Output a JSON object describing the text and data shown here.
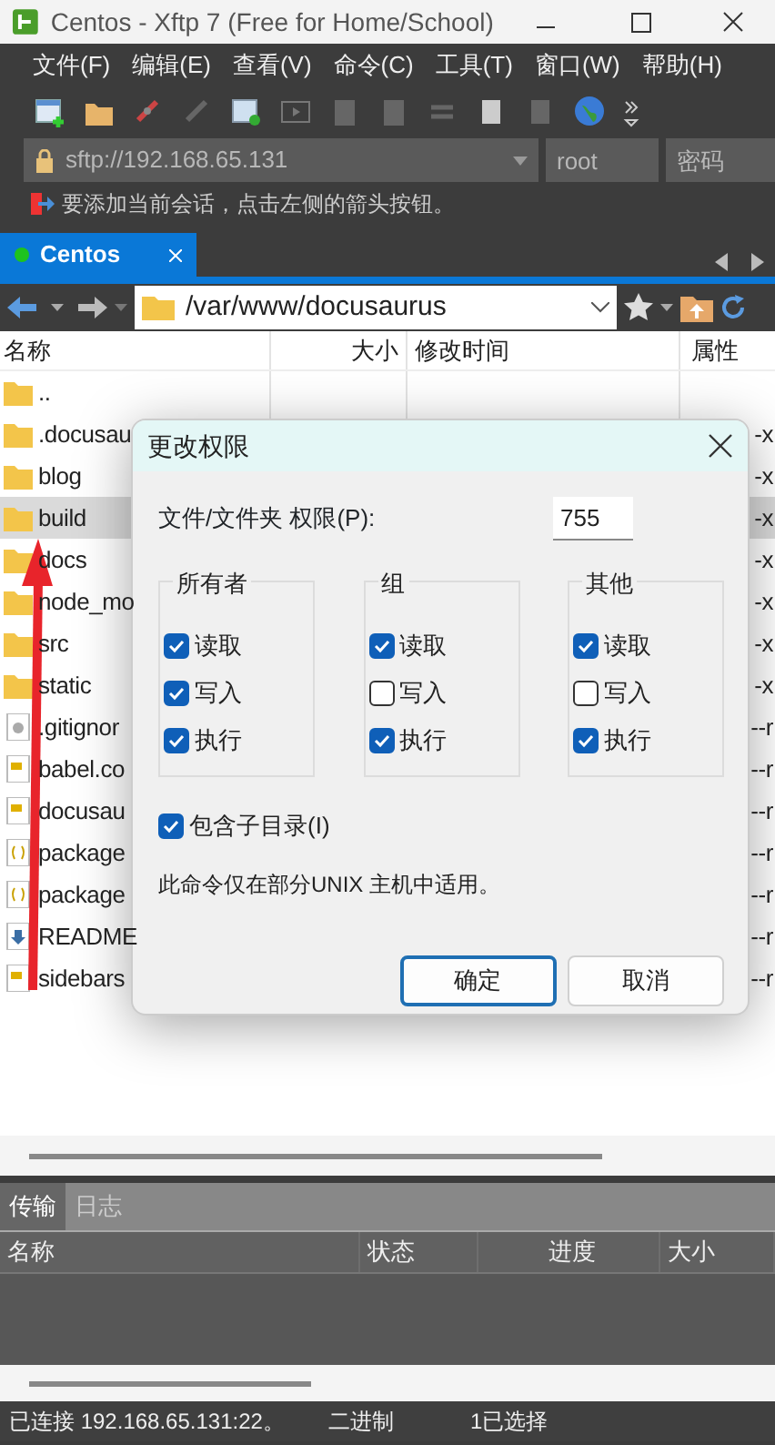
{
  "window": {
    "title": "Centos - Xftp 7 (Free for Home/School)"
  },
  "menu": [
    "文件(F)",
    "编辑(E)",
    "查看(V)",
    "命令(C)",
    "工具(T)",
    "窗口(W)",
    "帮助(H)"
  ],
  "address": {
    "url": "sftp://192.168.65.131",
    "user": "root",
    "placeholder": "密码"
  },
  "hint": "要添加当前会话，点击左侧的箭头按钮。",
  "session_tabs": [
    {
      "label": "Centos",
      "selected": true,
      "connected": true
    }
  ],
  "path": "/var/www/docusaurus",
  "file_table": {
    "columns": [
      "名称",
      "大小",
      "修改时间",
      "属性"
    ],
    "rows": [
      {
        "name": "..",
        "kind": "folder",
        "selected": false
      },
      {
        "name": ".docusau",
        "kind": "folder",
        "attributes": "-x",
        "selected": false
      },
      {
        "name": "blog",
        "kind": "folder",
        "attributes": "-x",
        "selected": false
      },
      {
        "name": "build",
        "kind": "folder",
        "attributes": "-x",
        "selected": true
      },
      {
        "name": "docs",
        "kind": "folder",
        "attributes": "-x",
        "selected": false
      },
      {
        "name": "node_mo",
        "kind": "folder",
        "attributes": "-x",
        "selected": false
      },
      {
        "name": "src",
        "kind": "folder",
        "attributes": "-x",
        "selected": false
      },
      {
        "name": "static",
        "kind": "folder",
        "attributes": "-x",
        "selected": false
      },
      {
        "name": ".gitignor",
        "kind": "config",
        "attributes": "--r",
        "selected": false
      },
      {
        "name": "babel.co",
        "kind": "script",
        "attributes": "--r",
        "selected": false
      },
      {
        "name": "docusau",
        "kind": "script",
        "attributes": "--r",
        "selected": false
      },
      {
        "name": "package",
        "kind": "json",
        "attributes": "--r",
        "selected": false
      },
      {
        "name": "package",
        "kind": "json",
        "attributes": "--r",
        "selected": false
      },
      {
        "name": "README",
        "kind": "markdown",
        "attributes": "--r",
        "selected": false
      },
      {
        "name": "sidebars",
        "kind": "script",
        "attributes": "--r",
        "selected": false
      }
    ]
  },
  "dialog": {
    "title": "更改权限",
    "permission_label": "文件/文件夹 权限(P):",
    "permission_value": "755",
    "groups": [
      {
        "label": "所有者",
        "options": [
          {
            "label": "读取",
            "checked": true
          },
          {
            "label": "写入",
            "checked": true
          },
          {
            "label": "执行",
            "checked": true
          }
        ]
      },
      {
        "label": "组",
        "options": [
          {
            "label": "读取",
            "checked": true
          },
          {
            "label": "写入",
            "checked": false
          },
          {
            "label": "执行",
            "checked": true
          }
        ]
      },
      {
        "label": "其他",
        "options": [
          {
            "label": "读取",
            "checked": true
          },
          {
            "label": "写入",
            "checked": false
          },
          {
            "label": "执行",
            "checked": true
          }
        ]
      }
    ],
    "recursive": {
      "label": "包含子目录(I)",
      "checked": true
    },
    "note": "此命令仅在部分UNIX 主机中适用。",
    "buttons": [
      {
        "label": "确定",
        "default": true
      },
      {
        "label": "取消",
        "default": false
      }
    ]
  },
  "transfer_panel": {
    "tabs": [
      {
        "label": "传输",
        "selected": true
      },
      {
        "label": "日志",
        "selected": false
      }
    ],
    "columns": [
      "名称",
      "状态",
      "进度",
      "大小"
    ]
  },
  "status_bar": [
    "已连接 192.168.65.131:22。",
    "二进制",
    "1已选择"
  ]
}
